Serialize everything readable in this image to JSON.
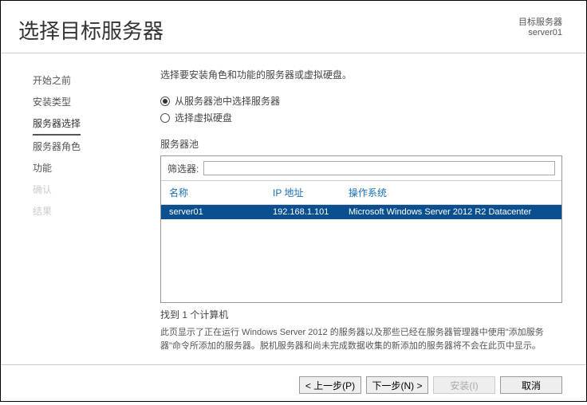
{
  "header": {
    "title": "选择目标服务器",
    "dest_label": "目标服务器",
    "dest_value": "server01"
  },
  "sidebar": {
    "steps": [
      "开始之前",
      "安装类型",
      "服务器选择",
      "服务器角色",
      "功能",
      "确认",
      "结果"
    ]
  },
  "main": {
    "instruction": "选择要安装角色和功能的服务器或虚拟硬盘。",
    "radio1": "从服务器池中选择服务器",
    "radio2": "选择虚拟硬盘",
    "pool_label": "服务器池",
    "filter_label": "筛选器:",
    "filter_value": "",
    "columns": {
      "name": "名称",
      "ip": "IP 地址",
      "os": "操作系统"
    },
    "rows": [
      {
        "name": "server01",
        "ip": "192.168.1.101",
        "os": "Microsoft Windows Server 2012 R2 Datacenter"
      }
    ],
    "count": "找到 1 个计算机",
    "description": "此页显示了正在运行 Windows Server 2012 的服务器以及那些已经在服务器管理器中使用\"添加服务器\"命令所添加的服务器。脱机服务器和尚未完成数据收集的新添加的服务器将不会在此页中显示。"
  },
  "footer": {
    "prev": "< 上一步(P)",
    "next": "下一步(N) >",
    "install": "安装(I)",
    "cancel": "取消"
  }
}
